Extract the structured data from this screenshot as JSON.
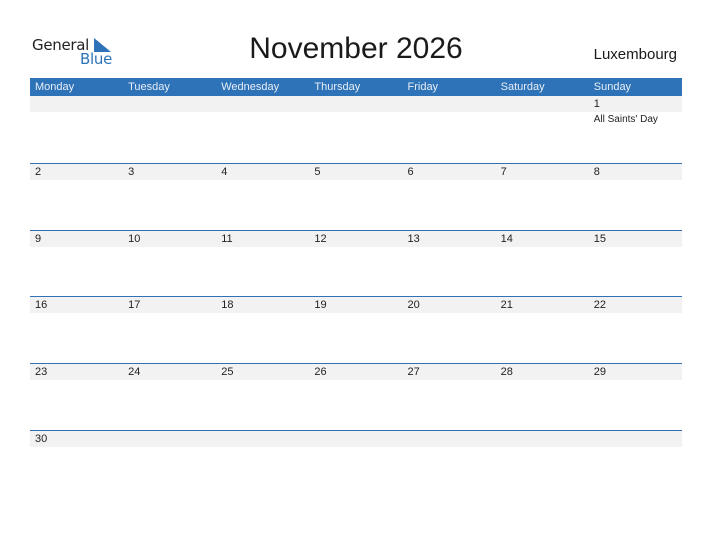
{
  "logo": {
    "line1": "General",
    "line2": "Blue"
  },
  "title": "November 2026",
  "country": "Luxembourg",
  "colors": {
    "accent": "#2e73b8",
    "strip": "#f2f2f2"
  },
  "weekdays": [
    "Monday",
    "Tuesday",
    "Wednesday",
    "Thursday",
    "Friday",
    "Saturday",
    "Sunday"
  ],
  "weeks": [
    [
      {
        "day": ""
      },
      {
        "day": ""
      },
      {
        "day": ""
      },
      {
        "day": ""
      },
      {
        "day": ""
      },
      {
        "day": ""
      },
      {
        "day": "1",
        "event": "All Saints' Day"
      }
    ],
    [
      {
        "day": "2"
      },
      {
        "day": "3"
      },
      {
        "day": "4"
      },
      {
        "day": "5"
      },
      {
        "day": "6"
      },
      {
        "day": "7"
      },
      {
        "day": "8"
      }
    ],
    [
      {
        "day": "9"
      },
      {
        "day": "10"
      },
      {
        "day": "11"
      },
      {
        "day": "12"
      },
      {
        "day": "13"
      },
      {
        "day": "14"
      },
      {
        "day": "15"
      }
    ],
    [
      {
        "day": "16"
      },
      {
        "day": "17"
      },
      {
        "day": "18"
      },
      {
        "day": "19"
      },
      {
        "day": "20"
      },
      {
        "day": "21"
      },
      {
        "day": "22"
      }
    ],
    [
      {
        "day": "23"
      },
      {
        "day": "24"
      },
      {
        "day": "25"
      },
      {
        "day": "26"
      },
      {
        "day": "27"
      },
      {
        "day": "28"
      },
      {
        "day": "29"
      }
    ],
    [
      {
        "day": "30"
      },
      {
        "day": ""
      },
      {
        "day": ""
      },
      {
        "day": ""
      },
      {
        "day": ""
      },
      {
        "day": ""
      },
      {
        "day": ""
      }
    ]
  ]
}
